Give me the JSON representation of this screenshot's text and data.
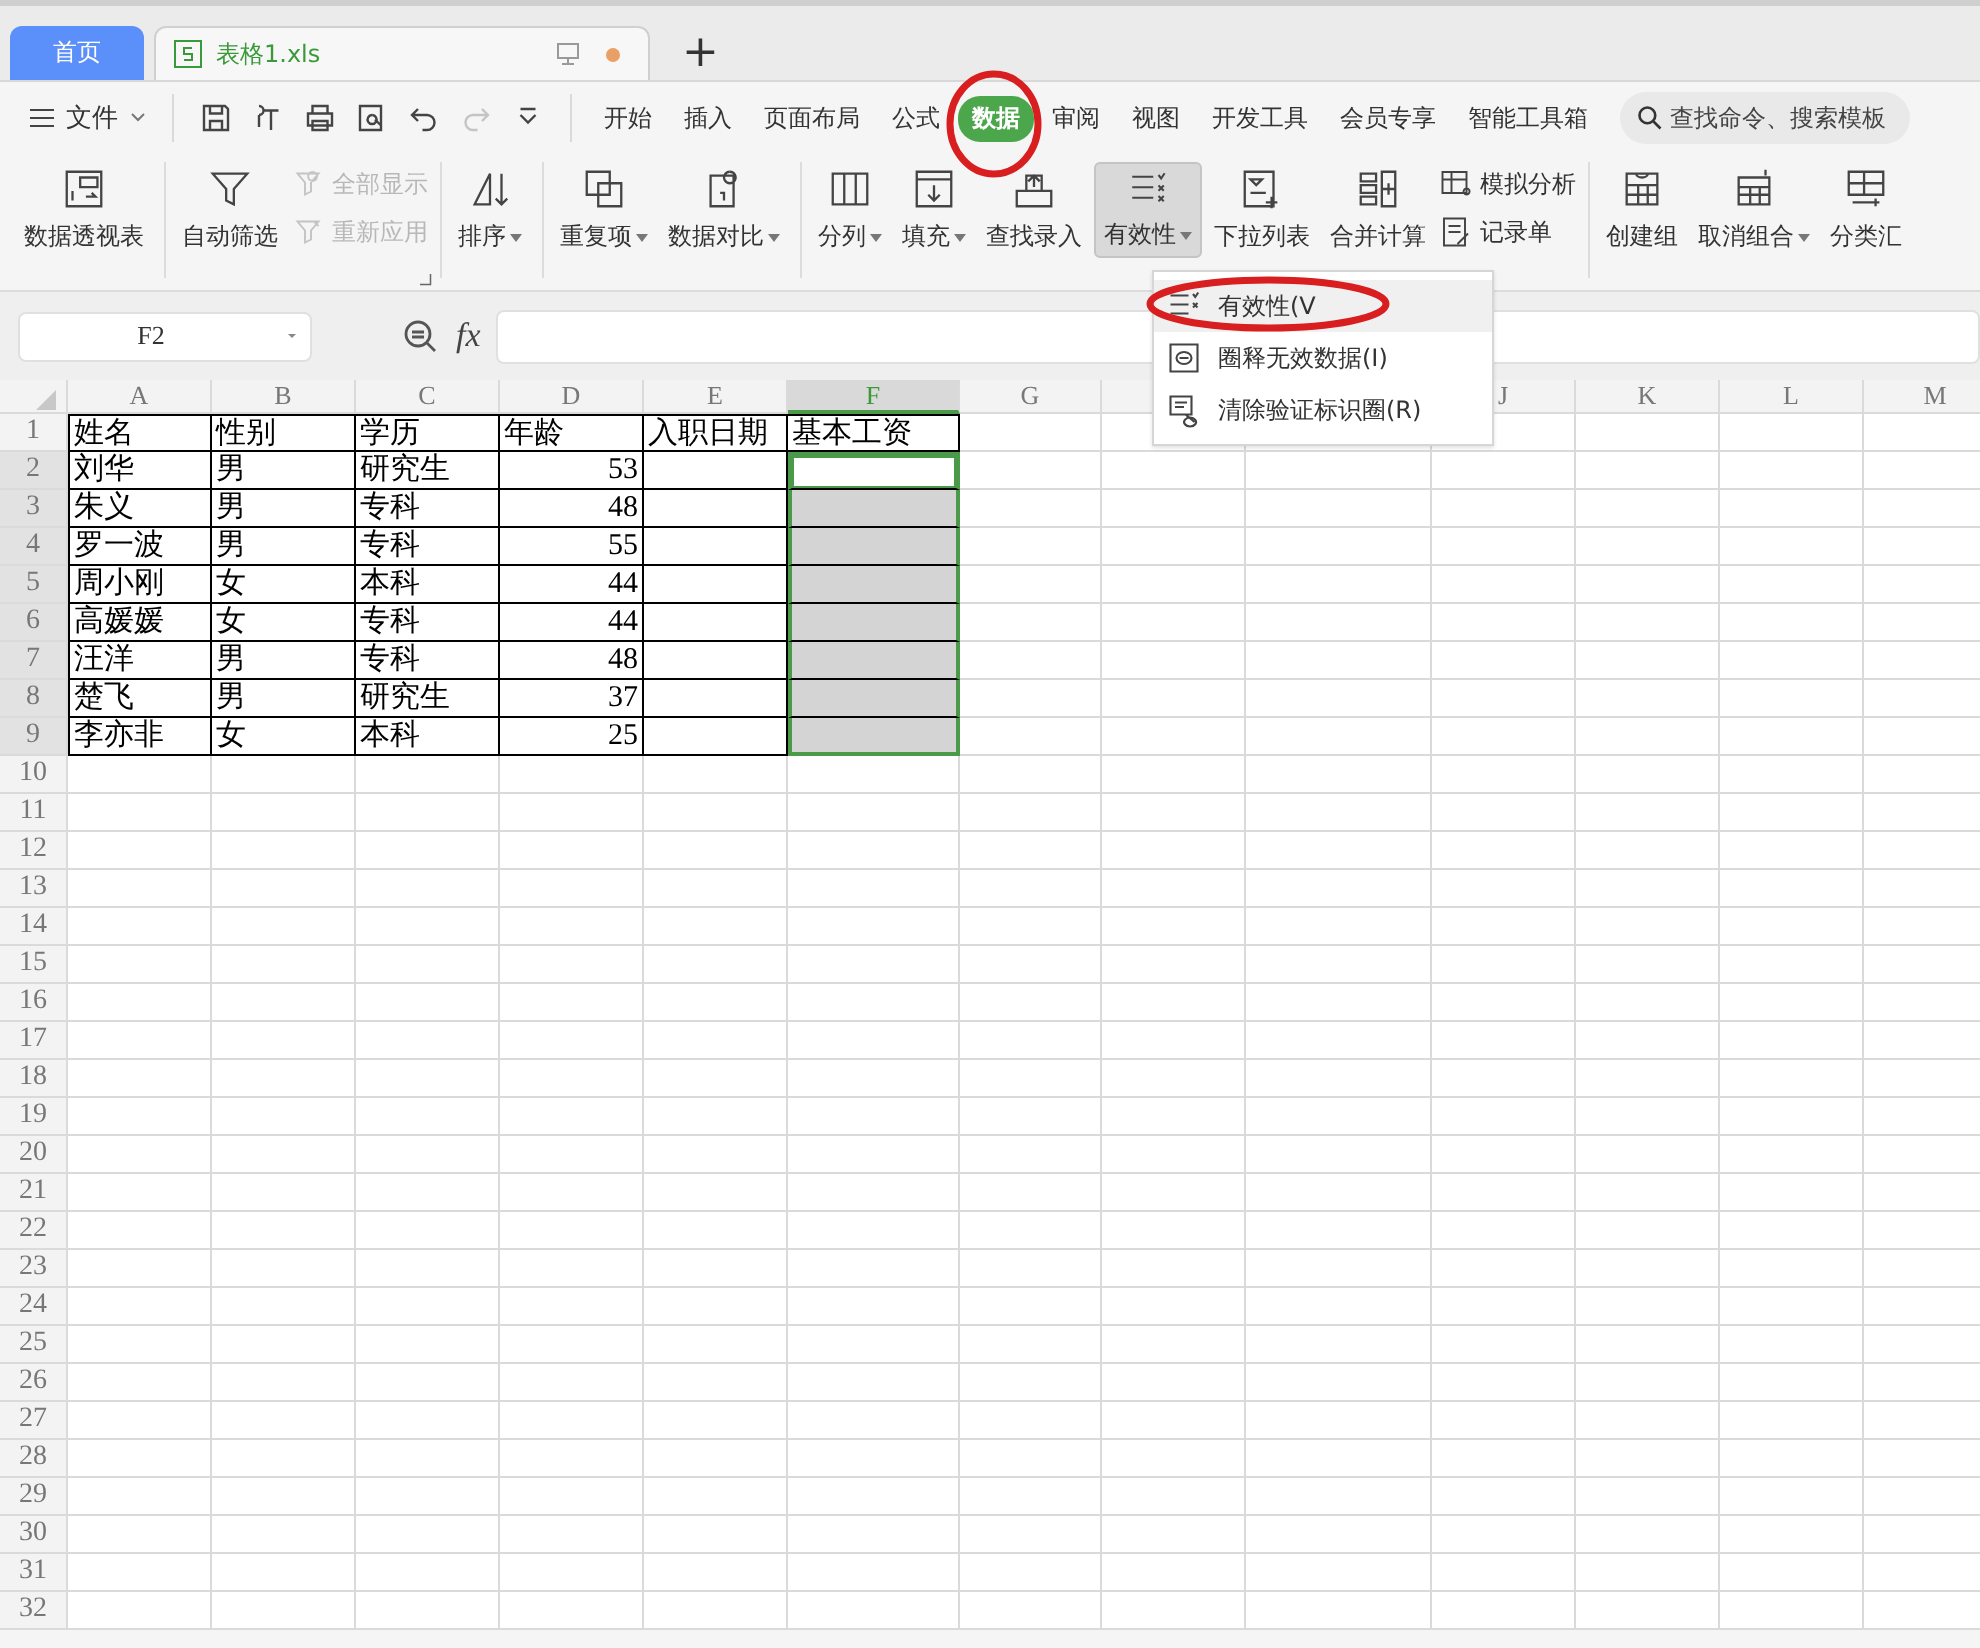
{
  "tabs": [
    {
      "label": "首页",
      "kind": "home",
      "selected": false
    },
    {
      "label": "表格1.xls",
      "kind": "file",
      "selected": true,
      "unsaved": true
    }
  ],
  "new_tab": "+",
  "file_menu": "文件",
  "quick_access": [
    {
      "disabled": false
    },
    {
      "disabled": false
    },
    {
      "disabled": false
    },
    {
      "disabled": false
    },
    {
      "disabled": false
    },
    {
      "disabled": true
    },
    {
      "disabled": false
    }
  ],
  "menus": [
    {
      "label": "开始",
      "selected": false
    },
    {
      "label": "插入",
      "selected": false
    },
    {
      "label": "页面布局",
      "selected": false
    },
    {
      "label": "公式",
      "selected": false
    },
    {
      "label": "数据",
      "selected": true
    },
    {
      "label": "审阅",
      "selected": false
    },
    {
      "label": "视图",
      "selected": false
    },
    {
      "label": "开发工具",
      "selected": false
    },
    {
      "label": "会员专享",
      "selected": false
    },
    {
      "label": "智能工具箱",
      "selected": false
    }
  ],
  "search": {
    "placeholder": "查找命令、搜索模板"
  },
  "ribbon": {
    "groups": [
      {
        "launcher": false,
        "items": [
          {
            "kind": "large",
            "label": "数据透视表",
            "dropdown": false,
            "pressed": false
          }
        ]
      },
      {
        "launcher": true,
        "items": [
          {
            "kind": "large",
            "label": "自动筛选",
            "dropdown": false,
            "pressed": false
          },
          {
            "kind": "stack",
            "items": [
              {
                "label": "全部显示",
                "disabled": true
              },
              {
                "label": "重新应用",
                "disabled": true
              }
            ]
          }
        ]
      },
      {
        "launcher": false,
        "items": [
          {
            "kind": "large",
            "label": "排序",
            "dropdown": true,
            "pressed": false
          }
        ]
      },
      {
        "launcher": false,
        "items": [
          {
            "kind": "large",
            "label": "重复项",
            "dropdown": true,
            "pressed": false
          },
          {
            "kind": "large",
            "label": "数据对比",
            "dropdown": true,
            "pressed": false
          }
        ]
      },
      {
        "launcher": false,
        "items": [
          {
            "kind": "large",
            "label": "分列",
            "dropdown": true,
            "pressed": false
          },
          {
            "kind": "large",
            "label": "填充",
            "dropdown": true,
            "pressed": false
          },
          {
            "kind": "large",
            "label": "查找录入",
            "dropdown": false,
            "pressed": false
          },
          {
            "kind": "large",
            "label": "有效性",
            "dropdown": true,
            "pressed": true
          },
          {
            "kind": "large",
            "label": "下拉列表",
            "dropdown": false,
            "pressed": false
          },
          {
            "kind": "large",
            "label": "合并计算",
            "dropdown": false,
            "pressed": false
          },
          {
            "kind": "stack",
            "items": [
              {
                "label": "模拟分析",
                "disabled": false
              },
              {
                "label": "记录单",
                "disabled": false
              }
            ]
          }
        ]
      },
      {
        "launcher": false,
        "items": [
          {
            "kind": "large",
            "label": "创建组",
            "dropdown": false,
            "pressed": false
          },
          {
            "kind": "large",
            "label": "取消组合",
            "dropdown": true,
            "pressed": false
          },
          {
            "kind": "large",
            "label": "分类汇",
            "dropdown": false,
            "pressed": false
          }
        ]
      }
    ]
  },
  "name_box": "F2",
  "formula_label": "fx",
  "sheet": {
    "columns": [
      {
        "label": "A",
        "selected": false
      },
      {
        "label": "B",
        "selected": false
      },
      {
        "label": "C",
        "selected": false
      },
      {
        "label": "D",
        "selected": false
      },
      {
        "label": "E",
        "selected": false
      },
      {
        "label": "F",
        "selected": true
      },
      {
        "label": "G",
        "selected": false
      },
      {
        "selected": false
      },
      {},
      {
        "label": "J",
        "selected": false
      },
      {
        "label": "K",
        "selected": false
      },
      {
        "label": "L",
        "selected": false
      },
      {
        "label": "M",
        "selected": false
      }
    ],
    "rows": [
      {
        "label": "1",
        "selected": false,
        "cells": [
          {
            "text": "姓名",
            "kind": "text",
            "selected": false,
            "active": false
          },
          {
            "text": "性别",
            "kind": "text",
            "selected": false,
            "active": false
          },
          {
            "text": "学历",
            "kind": "text",
            "selected": false,
            "active": false
          },
          {
            "text": "年龄",
            "kind": "text",
            "selected": false,
            "active": false
          },
          {
            "text": "入职日期",
            "kind": "text",
            "selected": false,
            "active": false
          },
          {
            "text": "基本工资",
            "kind": "text",
            "selected": false,
            "active": false
          }
        ]
      },
      {
        "label": "2",
        "selected": true,
        "cells": [
          {
            "text": "刘华",
            "kind": "text",
            "selected": false,
            "active": false
          },
          {
            "text": "男",
            "kind": "text",
            "selected": false,
            "active": false
          },
          {
            "text": "研究生",
            "kind": "text",
            "selected": false,
            "active": false
          },
          {
            "text": "53",
            "kind": "number",
            "selected": false,
            "active": false
          },
          {
            "kind": "empty",
            "selected": false,
            "active": false
          },
          {
            "kind": "empty",
            "selected": true,
            "active": true
          }
        ]
      },
      {
        "label": "3",
        "selected": true,
        "cells": [
          {
            "text": "朱义",
            "kind": "text",
            "selected": false,
            "active": false
          },
          {
            "text": "男",
            "kind": "text",
            "selected": false,
            "active": false
          },
          {
            "text": "专科",
            "kind": "text",
            "selected": false,
            "active": false
          },
          {
            "text": "48",
            "kind": "number",
            "selected": false,
            "active": false
          },
          {
            "kind": "empty",
            "selected": false,
            "active": false
          },
          {
            "kind": "empty",
            "selected": true,
            "active": false
          }
        ]
      },
      {
        "label": "4",
        "selected": true,
        "cells": [
          {
            "text": "罗一波",
            "kind": "text",
            "selected": false,
            "active": false
          },
          {
            "text": "男",
            "kind": "text",
            "selected": false,
            "active": false
          },
          {
            "text": "专科",
            "kind": "text",
            "selected": false,
            "active": false
          },
          {
            "text": "55",
            "kind": "number",
            "selected": false,
            "active": false
          },
          {
            "kind": "empty",
            "selected": false,
            "active": false
          },
          {
            "kind": "empty",
            "selected": true,
            "active": false
          }
        ]
      },
      {
        "label": "5",
        "selected": true,
        "cells": [
          {
            "text": "周小刚",
            "kind": "text",
            "selected": false,
            "active": false
          },
          {
            "text": "女",
            "kind": "text",
            "selected": false,
            "active": false
          },
          {
            "text": "本科",
            "kind": "text",
            "selected": false,
            "active": false
          },
          {
            "text": "44",
            "kind": "number",
            "selected": false,
            "active": false
          },
          {
            "kind": "empty",
            "selected": false,
            "active": false
          },
          {
            "kind": "empty",
            "selected": true,
            "active": false
          }
        ]
      },
      {
        "label": "6",
        "selected": true,
        "cells": [
          {
            "text": "高媛媛",
            "kind": "text",
            "selected": false,
            "active": false
          },
          {
            "text": "女",
            "kind": "text",
            "selected": false,
            "active": false
          },
          {
            "text": "专科",
            "kind": "text",
            "selected": false,
            "active": false
          },
          {
            "text": "44",
            "kind": "number",
            "selected": false,
            "active": false
          },
          {
            "kind": "empty",
            "selected": false,
            "active": false
          },
          {
            "kind": "empty",
            "selected": true,
            "active": false
          }
        ]
      },
      {
        "label": "7",
        "selected": true,
        "cells": [
          {
            "text": "汪洋",
            "kind": "text",
            "selected": false,
            "active": false
          },
          {
            "text": "男",
            "kind": "text",
            "selected": false,
            "active": false
          },
          {
            "text": "专科",
            "kind": "text",
            "selected": false,
            "active": false
          },
          {
            "text": "48",
            "kind": "number",
            "selected": false,
            "active": false
          },
          {
            "kind": "empty",
            "selected": false,
            "active": false
          },
          {
            "kind": "empty",
            "selected": true,
            "active": false
          }
        ]
      },
      {
        "label": "8",
        "selected": true,
        "cells": [
          {
            "text": "楚飞",
            "kind": "text",
            "selected": false,
            "active": false
          },
          {
            "text": "男",
            "kind": "text",
            "selected": false,
            "active": false
          },
          {
            "text": "研究生",
            "kind": "text",
            "selected": false,
            "active": false
          },
          {
            "text": "37",
            "kind": "number",
            "selected": false,
            "active": false
          },
          {
            "kind": "empty",
            "selected": false,
            "active": false
          },
          {
            "kind": "empty",
            "selected": true,
            "active": false
          }
        ]
      },
      {
        "label": "9",
        "selected": true,
        "cells": [
          {
            "text": "李亦非",
            "kind": "text",
            "selected": false,
            "active": false
          },
          {
            "text": "女",
            "kind": "text",
            "selected": false,
            "active": false
          },
          {
            "text": "本科",
            "kind": "text",
            "selected": false,
            "active": false
          },
          {
            "text": "25",
            "kind": "number",
            "selected": false,
            "active": false
          },
          {
            "kind": "empty",
            "selected": false,
            "active": false
          },
          {
            "kind": "empty",
            "selected": true,
            "active": false
          }
        ]
      },
      {
        "label": "10",
        "selected": false
      },
      {
        "label": "11",
        "selected": false
      },
      {
        "label": "12",
        "selected": false
      },
      {
        "label": "13",
        "selected": false
      },
      {
        "label": "14",
        "selected": false
      },
      {
        "label": "15",
        "selected": false
      },
      {
        "label": "16",
        "selected": false
      },
      {
        "label": "17",
        "selected": false
      },
      {
        "label": "18",
        "selected": false
      },
      {
        "label": "19",
        "selected": false
      },
      {
        "label": "20",
        "selected": false
      },
      {
        "label": "21",
        "selected": false
      },
      {
        "label": "22",
        "selected": false
      },
      {
        "label": "23",
        "selected": false
      },
      {
        "label": "24",
        "selected": false
      },
      {
        "label": "25",
        "selected": false
      },
      {
        "label": "26",
        "selected": false
      },
      {
        "label": "27",
        "selected": false
      },
      {
        "label": "28",
        "selected": false
      },
      {
        "label": "29",
        "selected": false
      },
      {
        "label": "30",
        "selected": false
      },
      {
        "label": "31",
        "selected": false
      },
      {
        "label": "32",
        "selected": false
      }
    ]
  },
  "dropdown_menu": [
    {
      "label": "有效性(V",
      "highlighted": true
    },
    {
      "label": "圈释无效数据(I)",
      "highlighted": false
    },
    {
      "label": "清除验证标识圈(R)",
      "highlighted": false
    }
  ]
}
